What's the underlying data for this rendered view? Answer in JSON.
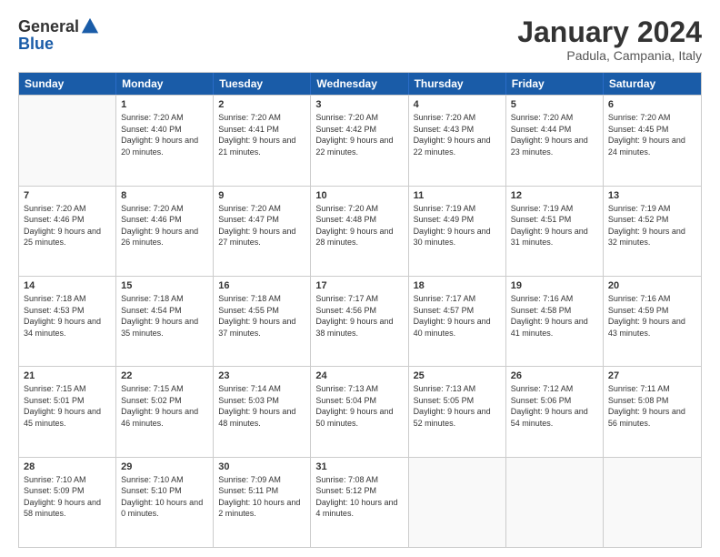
{
  "header": {
    "logo": {
      "general": "General",
      "blue": "Blue"
    },
    "title": "January 2024",
    "location": "Padula, Campania, Italy"
  },
  "calendar": {
    "days": [
      "Sunday",
      "Monday",
      "Tuesday",
      "Wednesday",
      "Thursday",
      "Friday",
      "Saturday"
    ],
    "weeks": [
      [
        {
          "day": "",
          "sunrise": "",
          "sunset": "",
          "daylight": ""
        },
        {
          "day": "1",
          "sunrise": "7:20 AM",
          "sunset": "4:40 PM",
          "daylight": "9 hours and 20 minutes."
        },
        {
          "day": "2",
          "sunrise": "7:20 AM",
          "sunset": "4:41 PM",
          "daylight": "9 hours and 21 minutes."
        },
        {
          "day": "3",
          "sunrise": "7:20 AM",
          "sunset": "4:42 PM",
          "daylight": "9 hours and 22 minutes."
        },
        {
          "day": "4",
          "sunrise": "7:20 AM",
          "sunset": "4:43 PM",
          "daylight": "9 hours and 22 minutes."
        },
        {
          "day": "5",
          "sunrise": "7:20 AM",
          "sunset": "4:44 PM",
          "daylight": "9 hours and 23 minutes."
        },
        {
          "day": "6",
          "sunrise": "7:20 AM",
          "sunset": "4:45 PM",
          "daylight": "9 hours and 24 minutes."
        }
      ],
      [
        {
          "day": "7",
          "sunrise": "7:20 AM",
          "sunset": "4:46 PM",
          "daylight": "9 hours and 25 minutes."
        },
        {
          "day": "8",
          "sunrise": "7:20 AM",
          "sunset": "4:46 PM",
          "daylight": "9 hours and 26 minutes."
        },
        {
          "day": "9",
          "sunrise": "7:20 AM",
          "sunset": "4:47 PM",
          "daylight": "9 hours and 27 minutes."
        },
        {
          "day": "10",
          "sunrise": "7:20 AM",
          "sunset": "4:48 PM",
          "daylight": "9 hours and 28 minutes."
        },
        {
          "day": "11",
          "sunrise": "7:19 AM",
          "sunset": "4:49 PM",
          "daylight": "9 hours and 30 minutes."
        },
        {
          "day": "12",
          "sunrise": "7:19 AM",
          "sunset": "4:51 PM",
          "daylight": "9 hours and 31 minutes."
        },
        {
          "day": "13",
          "sunrise": "7:19 AM",
          "sunset": "4:52 PM",
          "daylight": "9 hours and 32 minutes."
        }
      ],
      [
        {
          "day": "14",
          "sunrise": "7:18 AM",
          "sunset": "4:53 PM",
          "daylight": "9 hours and 34 minutes."
        },
        {
          "day": "15",
          "sunrise": "7:18 AM",
          "sunset": "4:54 PM",
          "daylight": "9 hours and 35 minutes."
        },
        {
          "day": "16",
          "sunrise": "7:18 AM",
          "sunset": "4:55 PM",
          "daylight": "9 hours and 37 minutes."
        },
        {
          "day": "17",
          "sunrise": "7:17 AM",
          "sunset": "4:56 PM",
          "daylight": "9 hours and 38 minutes."
        },
        {
          "day": "18",
          "sunrise": "7:17 AM",
          "sunset": "4:57 PM",
          "daylight": "9 hours and 40 minutes."
        },
        {
          "day": "19",
          "sunrise": "7:16 AM",
          "sunset": "4:58 PM",
          "daylight": "9 hours and 41 minutes."
        },
        {
          "day": "20",
          "sunrise": "7:16 AM",
          "sunset": "4:59 PM",
          "daylight": "9 hours and 43 minutes."
        }
      ],
      [
        {
          "day": "21",
          "sunrise": "7:15 AM",
          "sunset": "5:01 PM",
          "daylight": "9 hours and 45 minutes."
        },
        {
          "day": "22",
          "sunrise": "7:15 AM",
          "sunset": "5:02 PM",
          "daylight": "9 hours and 46 minutes."
        },
        {
          "day": "23",
          "sunrise": "7:14 AM",
          "sunset": "5:03 PM",
          "daylight": "9 hours and 48 minutes."
        },
        {
          "day": "24",
          "sunrise": "7:13 AM",
          "sunset": "5:04 PM",
          "daylight": "9 hours and 50 minutes."
        },
        {
          "day": "25",
          "sunrise": "7:13 AM",
          "sunset": "5:05 PM",
          "daylight": "9 hours and 52 minutes."
        },
        {
          "day": "26",
          "sunrise": "7:12 AM",
          "sunset": "5:06 PM",
          "daylight": "9 hours and 54 minutes."
        },
        {
          "day": "27",
          "sunrise": "7:11 AM",
          "sunset": "5:08 PM",
          "daylight": "9 hours and 56 minutes."
        }
      ],
      [
        {
          "day": "28",
          "sunrise": "7:10 AM",
          "sunset": "5:09 PM",
          "daylight": "9 hours and 58 minutes."
        },
        {
          "day": "29",
          "sunrise": "7:10 AM",
          "sunset": "5:10 PM",
          "daylight": "10 hours and 0 minutes."
        },
        {
          "day": "30",
          "sunrise": "7:09 AM",
          "sunset": "5:11 PM",
          "daylight": "10 hours and 2 minutes."
        },
        {
          "day": "31",
          "sunrise": "7:08 AM",
          "sunset": "5:12 PM",
          "daylight": "10 hours and 4 minutes."
        },
        {
          "day": "",
          "sunrise": "",
          "sunset": "",
          "daylight": ""
        },
        {
          "day": "",
          "sunrise": "",
          "sunset": "",
          "daylight": ""
        },
        {
          "day": "",
          "sunrise": "",
          "sunset": "",
          "daylight": ""
        }
      ]
    ]
  }
}
